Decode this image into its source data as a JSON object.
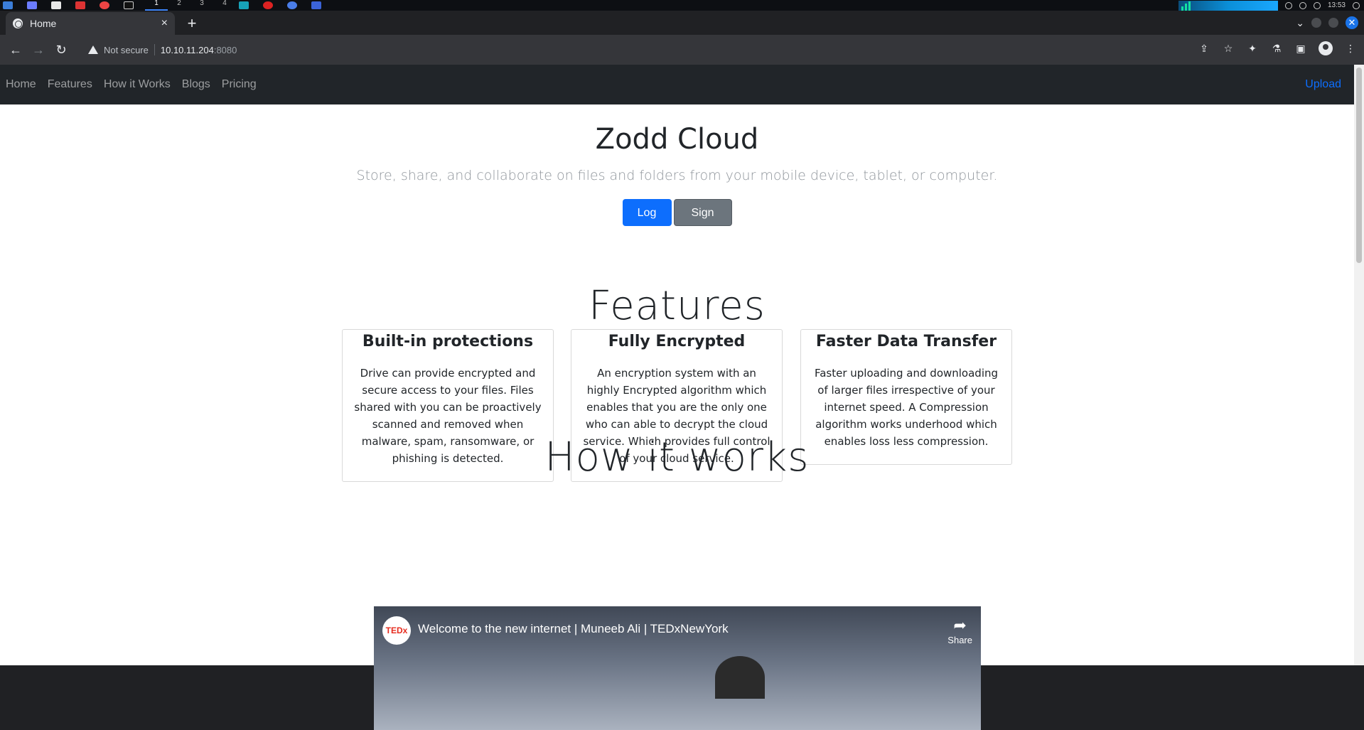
{
  "os": {
    "workspaces": [
      "1",
      "2",
      "3",
      "4"
    ],
    "clock": "13:53"
  },
  "browser": {
    "tab_title": "Home",
    "tab_close": "×",
    "new_tab": "+",
    "omnibox": {
      "security_label": "Not secure",
      "host": "10.10.11.204",
      "port": ":8080"
    }
  },
  "site": {
    "nav": {
      "items": [
        "Home",
        "Features",
        "How it Works",
        "Blogs",
        "Pricing"
      ],
      "upload": "Upload"
    },
    "hero": {
      "title": "Zodd Cloud",
      "subtitle": "Store, share, and collaborate on files and folders from your mobile device, tablet, or computer.",
      "login": "Log in",
      "signup": "Sign Up"
    },
    "features": {
      "heading": "Features",
      "cards": [
        {
          "title": "Built-in protections",
          "text": "Drive can provide encrypted and secure access to your files. Files shared with you can be proactively scanned and removed when malware, spam, ransomware, or phishing is detected."
        },
        {
          "title": "Fully Encrypted",
          "text": "An encryption system with an highly Encrypted algorithm which enables that you are the only one who can able to decrypt the cloud service. Which provides full control of your cloud service."
        },
        {
          "title": "Faster Data Transfer",
          "text": "Faster uploading and downloading of larger files irrespective of your internet speed. A Compression algorithm works underhood which enables loss less compression."
        }
      ]
    },
    "how_it_works": {
      "heading": "How it works",
      "video": {
        "channel_logo": "TEDx",
        "title": "Welcome to the new internet | Muneeb Ali | TEDxNewYork",
        "share_label": "Share"
      }
    }
  },
  "colors": {
    "primary": "#0d6efd",
    "secondary": "#6c757d",
    "navbar": "#212529"
  }
}
